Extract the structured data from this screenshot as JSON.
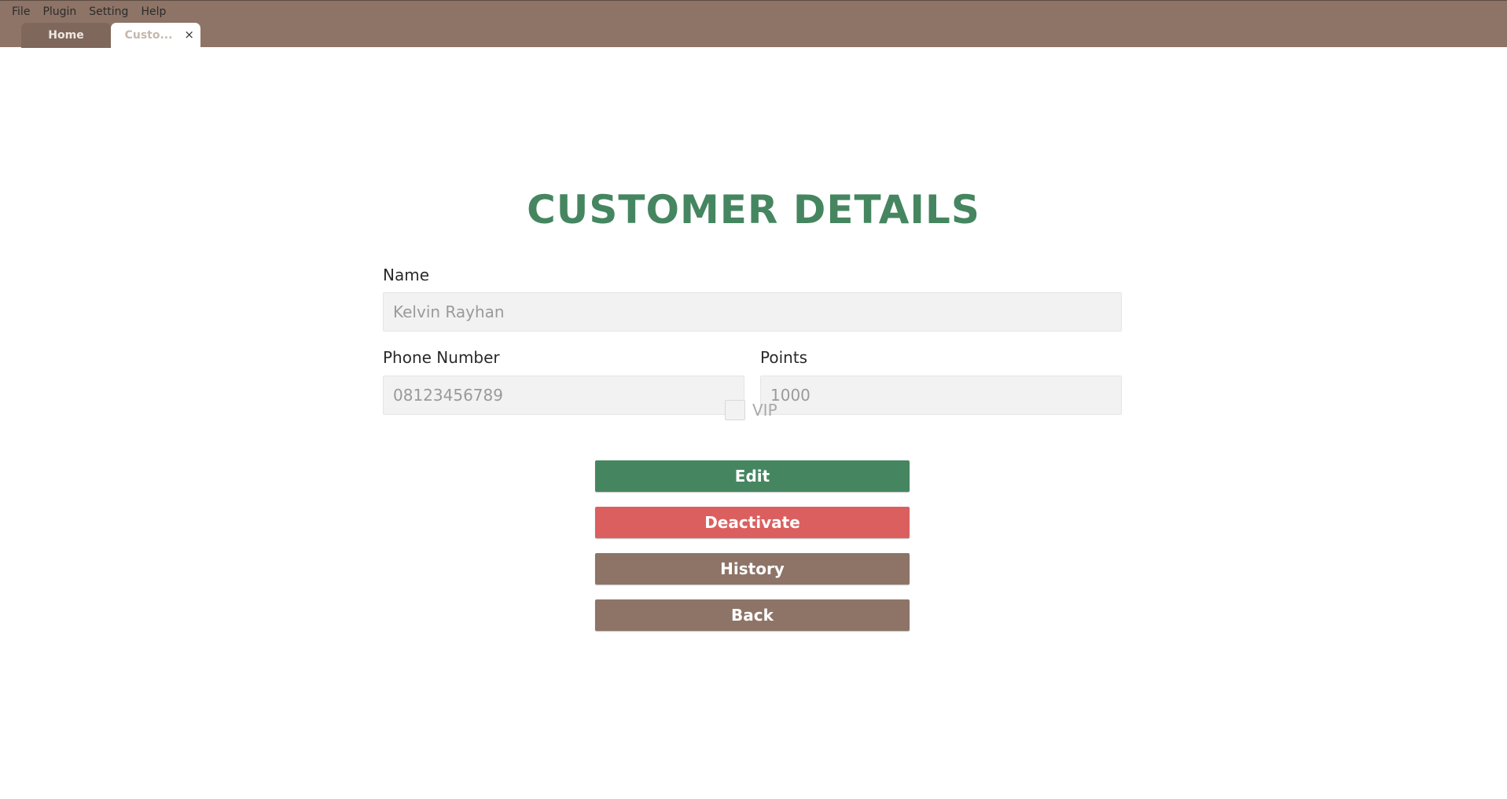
{
  "menu": {
    "items": [
      "File",
      "Plugin",
      "Setting",
      "Help"
    ]
  },
  "tabs": [
    {
      "label": "Home",
      "active": false
    },
    {
      "label": "Custo...",
      "active": true,
      "close": "×"
    }
  ],
  "page": {
    "title": "CUSTOMER DETAILS"
  },
  "form": {
    "name": {
      "label": "Name",
      "value": "Kelvin Rayhan"
    },
    "phone": {
      "label": "Phone Number",
      "value": "08123456789"
    },
    "points": {
      "label": "Points",
      "value": "1000"
    },
    "vip": {
      "label": "VIP",
      "checked": false
    }
  },
  "actions": {
    "edit": "Edit",
    "deactivate": "Deactivate",
    "history": "History",
    "back": "Back"
  },
  "colors": {
    "header": "#8d7467",
    "title": "#458660",
    "edit": "#458660",
    "deactivate": "#db5f5f",
    "history": "#8d7467",
    "back": "#8d7467"
  }
}
